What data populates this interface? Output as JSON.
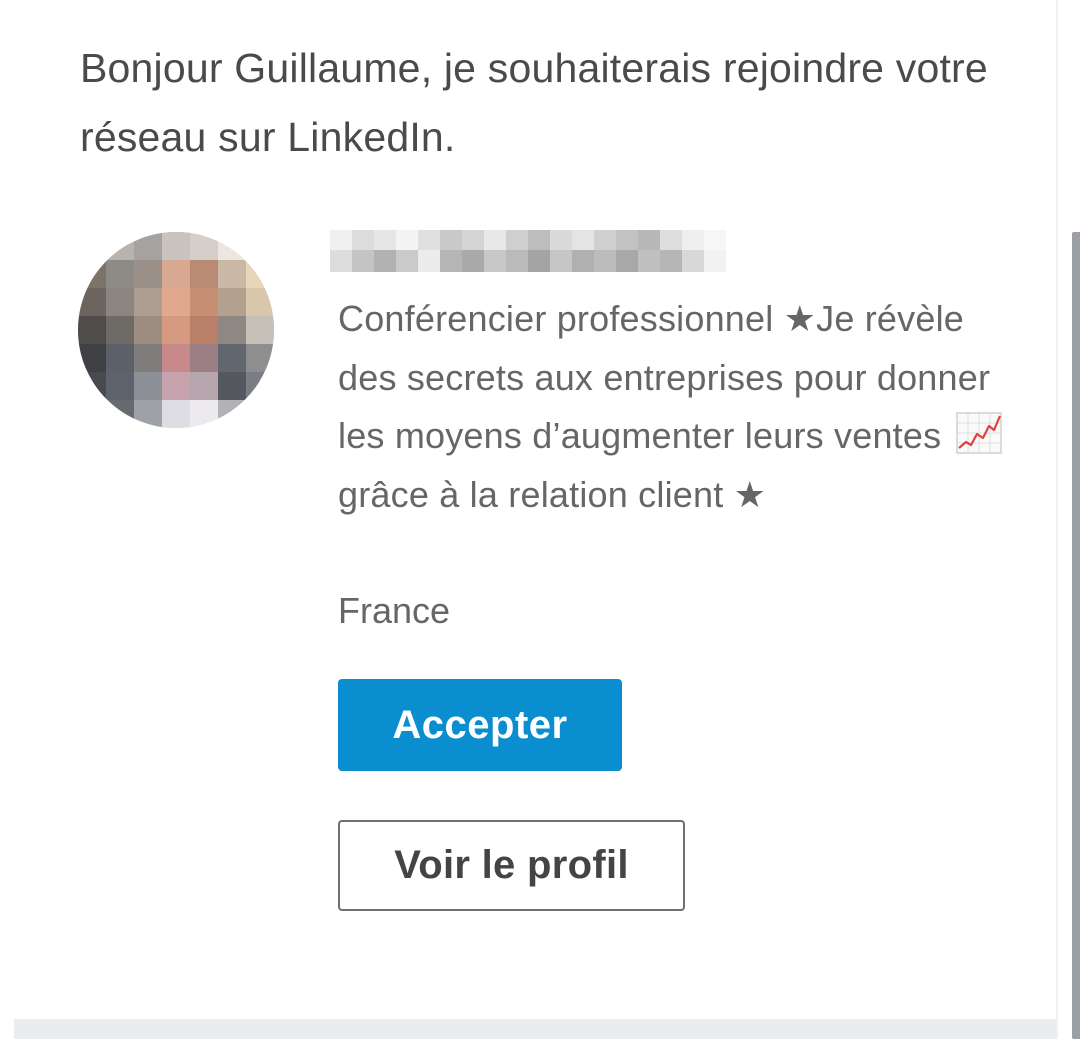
{
  "message": {
    "greeting": "Bonjour Guillaume, je souhaiterais rejoindre votre réseau sur LinkedIn."
  },
  "sender": {
    "name": "",
    "headline_before_emoji": "Conférencier professionnel ★Je révèle des secrets aux entreprises pour donner les moyens d’augmenter leurs ventes ",
    "headline_emoji": "chart-increasing-icon",
    "headline_after_emoji": "grâce à la relation client ★",
    "location": "France"
  },
  "actions": {
    "accept_label": "Accepter",
    "view_profile_label": "Voir le profil"
  },
  "colors": {
    "accent": "#0a8ed0",
    "text_primary": "#4a4a4a",
    "text_secondary": "#666666"
  }
}
